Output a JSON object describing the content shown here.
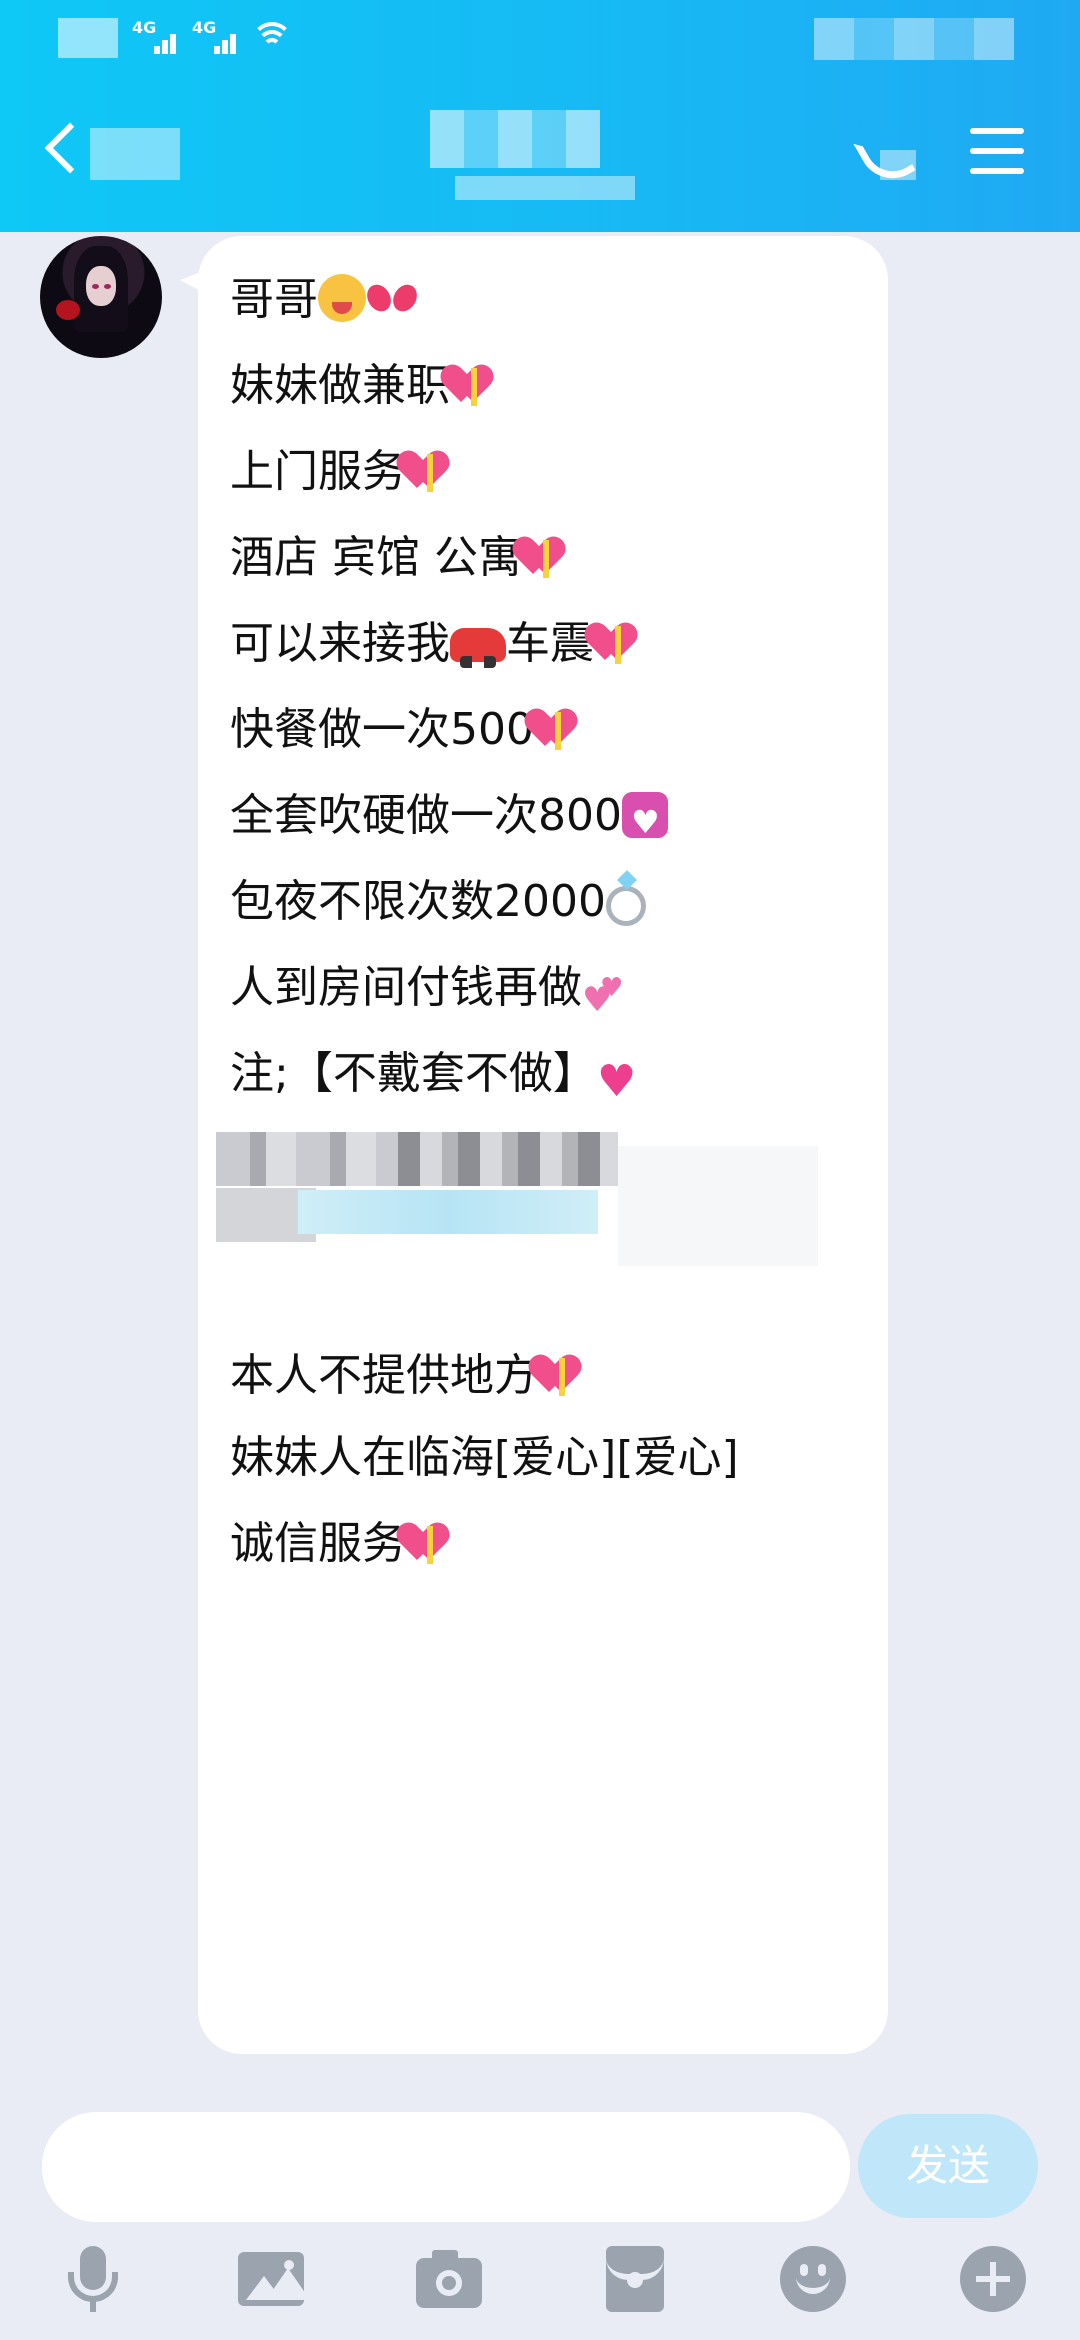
{
  "chat": {
    "messages": [
      {
        "text": " 哥哥",
        "emoji": [
          "squinting-tongue-face-emoji",
          "ribbon-emoji"
        ]
      },
      {
        "text": "妹妹做兼职",
        "emoji": [
          "heart-with-ribbon-emoji"
        ]
      },
      {
        "text": "上门服务",
        "emoji": [
          "heart-with-ribbon-emoji"
        ]
      },
      {
        "text": "酒店 宾馆 公寓",
        "emoji": [
          "heart-with-ribbon-emoji"
        ]
      },
      {
        "text": "可以来接我",
        "mid": "车震",
        "emoji": [
          "car-emoji",
          "heart-with-ribbon-emoji"
        ]
      },
      {
        "text": "快餐做一次500",
        "emoji": [
          "heart-with-ribbon-emoji"
        ]
      },
      {
        "text": "全套吹硬做一次800",
        "emoji": [
          "heart-decoration-emoji"
        ]
      },
      {
        "text": "包夜不限次数2000",
        "emoji": [
          "ring-emoji"
        ]
      },
      {
        "text": "人到房间付钱再做",
        "emoji": [
          "revolving-hearts-emoji"
        ]
      },
      {
        "text": "注;【不戴套不做】",
        "emoji": [
          "sparkling-heart-emoji"
        ]
      },
      {
        "text": "本人不提供地方",
        "emoji": [
          "heart-with-ribbon-emoji"
        ]
      },
      {
        "text": "妹妹人在临海[爱心][爱心]",
        "emoji": []
      },
      {
        "text": "诚信服务",
        "emoji": [
          "heart-with-ribbon-emoji"
        ]
      }
    ]
  },
  "input_bar": {
    "send_label": "发送",
    "placeholder": ""
  },
  "toolbar_icons": [
    "microphone-icon",
    "image-icon",
    "camera-icon",
    "red-packet-icon",
    "emoji-icon",
    "plus-icon"
  ],
  "colors": {
    "header": "#1bb9f5",
    "background": "#e9ecf4",
    "send_button": "#bfe7f9",
    "toolbar_icon": "#9aa3ae"
  }
}
